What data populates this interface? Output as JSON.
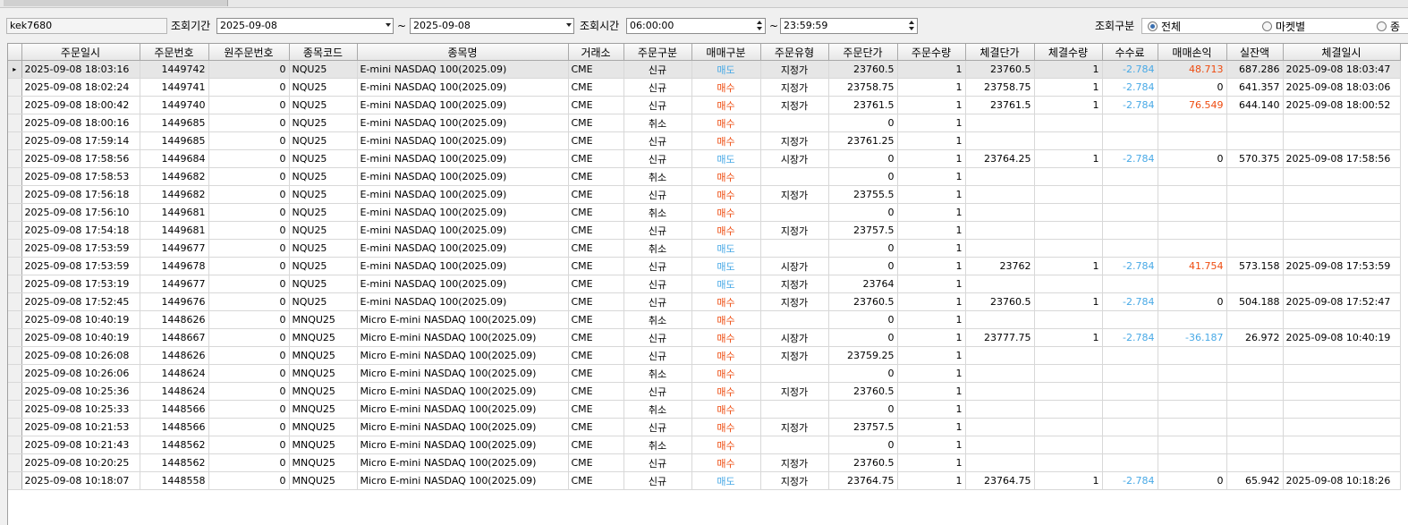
{
  "colors": {
    "buy": "#ee4b0f",
    "sell": "#48a9e6",
    "fee": "#48a9e6"
  },
  "filters": {
    "account_value": "kek7680",
    "period_label": "조회기간",
    "date_from": "2025-09-08",
    "tilde": "~",
    "date_to": "2025-09-08",
    "time_label": "조회시간",
    "time_from": "06:00:00",
    "time_to": "23:59:59",
    "type_label": "조회구분",
    "options": [
      "전체",
      "마켓별",
      "종"
    ],
    "selected_option": "전체"
  },
  "grid": {
    "columns": [
      "주문일시",
      "주문번호",
      "원주문번호",
      "종목코드",
      "종목명",
      "거래소",
      "주문구분",
      "매매구분",
      "주문유형",
      "주문단가",
      "주문수량",
      "체결단가",
      "체결수량",
      "수수료",
      "매매손익",
      "실잔액",
      "체결일시"
    ],
    "rows": [
      [
        "2025-09-08 18:03:16",
        "1449742",
        "0",
        "NQU25",
        "E-mini NASDAQ 100(2025.09)",
        "CME",
        "신규",
        "매도",
        "지정가",
        "23760.5",
        "1",
        "23760.5",
        "1",
        "-2.784",
        "48.713",
        "687.286",
        "2025-09-08 18:03:47"
      ],
      [
        "2025-09-08 18:02:24",
        "1449741",
        "0",
        "NQU25",
        "E-mini NASDAQ 100(2025.09)",
        "CME",
        "신규",
        "매수",
        "지정가",
        "23758.75",
        "1",
        "23758.75",
        "1",
        "-2.784",
        "0",
        "641.357",
        "2025-09-08 18:03:06"
      ],
      [
        "2025-09-08 18:00:42",
        "1449740",
        "0",
        "NQU25",
        "E-mini NASDAQ 100(2025.09)",
        "CME",
        "신규",
        "매수",
        "지정가",
        "23761.5",
        "1",
        "23761.5",
        "1",
        "-2.784",
        "76.549",
        "644.140",
        "2025-09-08 18:00:52"
      ],
      [
        "2025-09-08 18:00:16",
        "1449685",
        "0",
        "NQU25",
        "E-mini NASDAQ 100(2025.09)",
        "CME",
        "취소",
        "매수",
        "",
        "0",
        "1",
        "",
        "",
        "",
        "",
        "",
        ""
      ],
      [
        "2025-09-08 17:59:14",
        "1449685",
        "0",
        "NQU25",
        "E-mini NASDAQ 100(2025.09)",
        "CME",
        "신규",
        "매수",
        "지정가",
        "23761.25",
        "1",
        "",
        "",
        "",
        "",
        "",
        ""
      ],
      [
        "2025-09-08 17:58:56",
        "1449684",
        "0",
        "NQU25",
        "E-mini NASDAQ 100(2025.09)",
        "CME",
        "신규",
        "매도",
        "시장가",
        "0",
        "1",
        "23764.25",
        "1",
        "-2.784",
        "0",
        "570.375",
        "2025-09-08 17:58:56"
      ],
      [
        "2025-09-08 17:58:53",
        "1449682",
        "0",
        "NQU25",
        "E-mini NASDAQ 100(2025.09)",
        "CME",
        "취소",
        "매수",
        "",
        "0",
        "1",
        "",
        "",
        "",
        "",
        "",
        ""
      ],
      [
        "2025-09-08 17:56:18",
        "1449682",
        "0",
        "NQU25",
        "E-mini NASDAQ 100(2025.09)",
        "CME",
        "신규",
        "매수",
        "지정가",
        "23755.5",
        "1",
        "",
        "",
        "",
        "",
        "",
        ""
      ],
      [
        "2025-09-08 17:56:10",
        "1449681",
        "0",
        "NQU25",
        "E-mini NASDAQ 100(2025.09)",
        "CME",
        "취소",
        "매수",
        "",
        "0",
        "1",
        "",
        "",
        "",
        "",
        "",
        ""
      ],
      [
        "2025-09-08 17:54:18",
        "1449681",
        "0",
        "NQU25",
        "E-mini NASDAQ 100(2025.09)",
        "CME",
        "신규",
        "매수",
        "지정가",
        "23757.5",
        "1",
        "",
        "",
        "",
        "",
        "",
        ""
      ],
      [
        "2025-09-08 17:53:59",
        "1449677",
        "0",
        "NQU25",
        "E-mini NASDAQ 100(2025.09)",
        "CME",
        "취소",
        "매도",
        "",
        "0",
        "1",
        "",
        "",
        "",
        "",
        "",
        ""
      ],
      [
        "2025-09-08 17:53:59",
        "1449678",
        "0",
        "NQU25",
        "E-mini NASDAQ 100(2025.09)",
        "CME",
        "신규",
        "매도",
        "시장가",
        "0",
        "1",
        "23762",
        "1",
        "-2.784",
        "41.754",
        "573.158",
        "2025-09-08 17:53:59"
      ],
      [
        "2025-09-08 17:53:19",
        "1449677",
        "0",
        "NQU25",
        "E-mini NASDAQ 100(2025.09)",
        "CME",
        "신규",
        "매도",
        "지정가",
        "23764",
        "1",
        "",
        "",
        "",
        "",
        "",
        ""
      ],
      [
        "2025-09-08 17:52:45",
        "1449676",
        "0",
        "NQU25",
        "E-mini NASDAQ 100(2025.09)",
        "CME",
        "신규",
        "매수",
        "지정가",
        "23760.5",
        "1",
        "23760.5",
        "1",
        "-2.784",
        "0",
        "504.188",
        "2025-09-08 17:52:47"
      ],
      [
        "2025-09-08 10:40:19",
        "1448626",
        "0",
        "MNQU25",
        "Micro E-mini NASDAQ 100(2025.09)",
        "CME",
        "취소",
        "매수",
        "",
        "0",
        "1",
        "",
        "",
        "",
        "",
        "",
        ""
      ],
      [
        "2025-09-08 10:40:19",
        "1448667",
        "0",
        "MNQU25",
        "Micro E-mini NASDAQ 100(2025.09)",
        "CME",
        "신규",
        "매수",
        "시장가",
        "0",
        "1",
        "23777.75",
        "1",
        "-2.784",
        "-36.187",
        "26.972",
        "2025-09-08 10:40:19"
      ],
      [
        "2025-09-08 10:26:08",
        "1448626",
        "0",
        "MNQU25",
        "Micro E-mini NASDAQ 100(2025.09)",
        "CME",
        "신규",
        "매수",
        "지정가",
        "23759.25",
        "1",
        "",
        "",
        "",
        "",
        "",
        ""
      ],
      [
        "2025-09-08 10:26:06",
        "1448624",
        "0",
        "MNQU25",
        "Micro E-mini NASDAQ 100(2025.09)",
        "CME",
        "취소",
        "매수",
        "",
        "0",
        "1",
        "",
        "",
        "",
        "",
        "",
        ""
      ],
      [
        "2025-09-08 10:25:36",
        "1448624",
        "0",
        "MNQU25",
        "Micro E-mini NASDAQ 100(2025.09)",
        "CME",
        "신규",
        "매수",
        "지정가",
        "23760.5",
        "1",
        "",
        "",
        "",
        "",
        "",
        ""
      ],
      [
        "2025-09-08 10:25:33",
        "1448566",
        "0",
        "MNQU25",
        "Micro E-mini NASDAQ 100(2025.09)",
        "CME",
        "취소",
        "매수",
        "",
        "0",
        "1",
        "",
        "",
        "",
        "",
        "",
        ""
      ],
      [
        "2025-09-08 10:21:53",
        "1448566",
        "0",
        "MNQU25",
        "Micro E-mini NASDAQ 100(2025.09)",
        "CME",
        "신규",
        "매수",
        "지정가",
        "23757.5",
        "1",
        "",
        "",
        "",
        "",
        "",
        ""
      ],
      [
        "2025-09-08 10:21:43",
        "1448562",
        "0",
        "MNQU25",
        "Micro E-mini NASDAQ 100(2025.09)",
        "CME",
        "취소",
        "매수",
        "",
        "0",
        "1",
        "",
        "",
        "",
        "",
        "",
        ""
      ],
      [
        "2025-09-08 10:20:25",
        "1448562",
        "0",
        "MNQU25",
        "Micro E-mini NASDAQ 100(2025.09)",
        "CME",
        "신규",
        "매수",
        "지정가",
        "23760.5",
        "1",
        "",
        "",
        "",
        "",
        "",
        ""
      ],
      [
        "2025-09-08 10:18:07",
        "1448558",
        "0",
        "MNQU25",
        "Micro E-mini NASDAQ 100(2025.09)",
        "CME",
        "신규",
        "매도",
        "지정가",
        "23764.75",
        "1",
        "23764.75",
        "1",
        "-2.784",
        "0",
        "65.942",
        "2025-09-08 10:18:26"
      ]
    ]
  }
}
